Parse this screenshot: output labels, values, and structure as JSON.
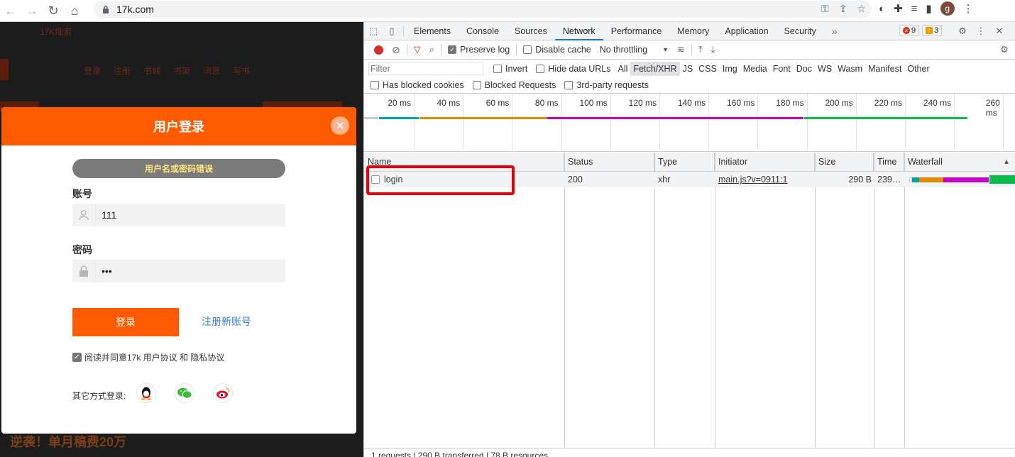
{
  "browser": {
    "url": "17k.com",
    "avatar_letter": "g"
  },
  "page": {
    "bg_site_name": "17K搜索",
    "bg_nav": [
      "登录",
      "注册",
      "书城",
      "书架",
      "消息",
      "写书"
    ],
    "bottom_promo": "逆袭！单月稿费20万",
    "modal": {
      "title": "用户登录",
      "error": "用户名或密码错误",
      "account_label": "账号",
      "account_value": "111",
      "password_label": "密码",
      "password_value": "•••",
      "login_button": "登录",
      "register_link": "注册新账号",
      "agree_text": "阅读并同意17k 用户协议 和 隐私协议",
      "other_login": "其它方式登录:"
    }
  },
  "devtools": {
    "tabs": [
      "Elements",
      "Console",
      "Sources",
      "Network",
      "Performance",
      "Memory",
      "Application",
      "Security"
    ],
    "active_tab": "Network",
    "more_tabs": "»",
    "error_count": "9",
    "warning_count": "3",
    "toolbar": {
      "preserve_log": "Preserve log",
      "disable_cache": "Disable cache",
      "throttling": "No throttling"
    },
    "filter": {
      "placeholder": "Filter",
      "invert": "Invert",
      "hide_data_urls": "Hide data URLs",
      "types": [
        "All",
        "Fetch/XHR",
        "JS",
        "CSS",
        "Img",
        "Media",
        "Font",
        "Doc",
        "WS",
        "Wasm",
        "Manifest",
        "Other"
      ],
      "active_type": "Fetch/XHR",
      "blocked_cookies": "Has blocked cookies",
      "blocked_requests": "Blocked Requests",
      "third_party": "3rd-party requests"
    },
    "overview_ticks": [
      "20 ms",
      "40 ms",
      "60 ms",
      "80 ms",
      "100 ms",
      "120 ms",
      "140 ms",
      "160 ms",
      "180 ms",
      "200 ms",
      "220 ms",
      "240 ms",
      "260 ms"
    ],
    "columns": [
      "Name",
      "Status",
      "Type",
      "Initiator",
      "Size",
      "Time",
      "Waterfall"
    ],
    "sort_indicator": "▲",
    "rows": [
      {
        "name": "login",
        "status": "200",
        "type": "xhr",
        "initiator": "main.js?v=0911:1",
        "size": "290 B",
        "time": "239…"
      }
    ],
    "status_bar": "1 requests  |  290 B transferred  |  78 B resources"
  },
  "colors": {
    "accent": "#ff5a00",
    "devtools_blue": "#1a73e8",
    "highlight_red": "#e8000b"
  }
}
